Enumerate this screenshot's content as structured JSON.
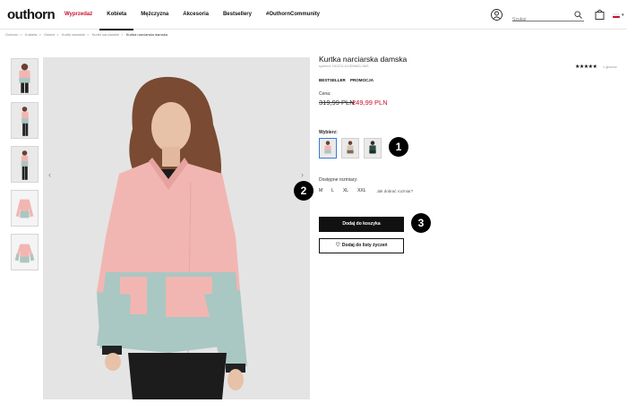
{
  "header": {
    "logo": "outhorn",
    "nav": [
      {
        "label": "Wyprzedaż"
      },
      {
        "label": "Kobieta"
      },
      {
        "label": "Mężczyzna"
      },
      {
        "label": "Akcesoria"
      },
      {
        "label": "Bestsellery"
      },
      {
        "label": "#OuthornCommunity"
      }
    ],
    "search_placeholder": "Szukaj",
    "icons": [
      "user-icon",
      "search-icon",
      "cart-icon",
      "flag-icon"
    ]
  },
  "breadcrumb": [
    "Outhorn",
    "Kobieta",
    "Odzież",
    "Kurtki damskie",
    "Kurtki narciarskie",
    "Kurtka narciarska damska"
  ],
  "product": {
    "title": "Kurtka narciarska damska",
    "sku": "symbol: HOZ21-KUDN601-56S",
    "rating_stars": "★★★★★",
    "rating_value": 5,
    "rating_count": "1 głosów",
    "badges": [
      "BESTSELLER",
      "PROMOCJA"
    ],
    "price_label": "Cena:",
    "old_price": "319,99 PLN",
    "new_price": "249,99 PLN",
    "color_label": "Wybierz:",
    "swatches": [
      "pink",
      "beige",
      "dark-green"
    ],
    "sizes_label": "Dostępne rozmiary:",
    "sizes": [
      "M",
      "L",
      "XL",
      "XXL"
    ],
    "size_guide": "Jak dobrać rozmiar?",
    "add_to_cart": "Dodaj do koszyka",
    "add_to_wishlist": "Dodaj do listy życzeń"
  },
  "markers": [
    "1",
    "2",
    "3"
  ],
  "colors": {
    "sale_red": "#c8102e",
    "jacket_pink": "#f2b6b2",
    "jacket_mint": "#a9c7c3",
    "button_black": "#111111"
  }
}
